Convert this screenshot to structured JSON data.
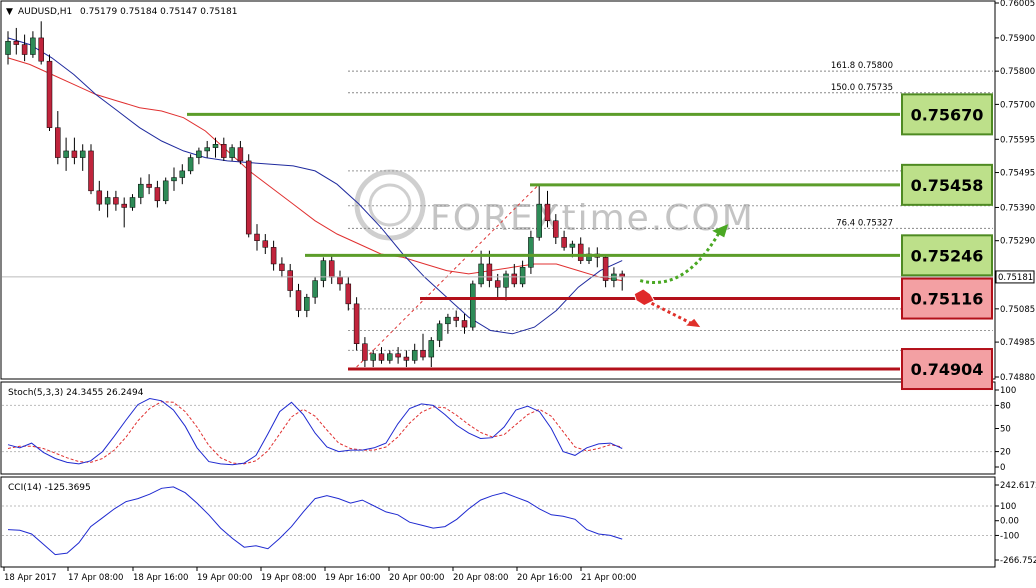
{
  "header": {
    "symbol": "AUDUSD,H1",
    "ohlc": "0.75179 0.75184 0.75147 0.75181"
  },
  "watermark": "FOREXtime.COM",
  "colors": {
    "bull": "#2e8b57",
    "bear": "#c0243c",
    "blue_ma": "#1f2a9e",
    "red_ma": "#e03030",
    "support": "#b3101a",
    "resistance": "#5c9d2a"
  },
  "fib_labels": [
    {
      "text": "161.8  0.75800",
      "price": 0.758
    },
    {
      "text": "150.0  0.75735",
      "price": 0.75735
    },
    {
      "text": "76.4  0.75327",
      "price": 0.75327
    }
  ],
  "price_axis": {
    "ticks": [
      "0.76005",
      "0.75900",
      "0.75800",
      "0.75700",
      "0.75595",
      "0.75495",
      "0.75390",
      "0.75290",
      "0.75190",
      "0.75085",
      "0.74985",
      "0.74880"
    ],
    "current": "0.75181"
  },
  "levels": [
    {
      "label": "0.75670",
      "kind": "resistance"
    },
    {
      "label": "0.75458",
      "kind": "resistance"
    },
    {
      "label": "0.75246",
      "kind": "resistance"
    },
    {
      "label": "0.75116",
      "kind": "support"
    },
    {
      "label": "0.74904",
      "kind": "support"
    }
  ],
  "stoch": {
    "title": "Stoch(5,3,3) 24.3455 26.2494",
    "ticks": [
      "100",
      "80",
      "50",
      "20",
      "0"
    ]
  },
  "cci": {
    "title": "CCI(14) -125.3695",
    "ticks": [
      "242.6172",
      "100",
      "0.00",
      "-100",
      "-266.7527"
    ]
  },
  "time_axis": [
    "18 Apr 2017",
    "17 Apr 08:00",
    "18 Apr 16:00",
    "19 Apr 00:00",
    "19 Apr 08:00",
    "19 Apr 16:00",
    "20 Apr 00:00",
    "20 Apr 08:00",
    "20 Apr 16:00",
    "21 Apr 00:00"
  ],
  "chart_data": {
    "type": "candlestick",
    "title": "AUDUSD,H1",
    "ylim": [
      0.7488,
      0.76005
    ],
    "candles": [
      [
        0.7585,
        0.7592,
        0.7582,
        0.7589
      ],
      [
        0.7589,
        0.7593,
        0.7585,
        0.7588
      ],
      [
        0.7588,
        0.7591,
        0.7583,
        0.7585
      ],
      [
        0.7585,
        0.7592,
        0.7584,
        0.759
      ],
      [
        0.759,
        0.7595,
        0.7582,
        0.7583
      ],
      [
        0.7583,
        0.7585,
        0.7562,
        0.7563
      ],
      [
        0.7563,
        0.7568,
        0.7552,
        0.7554
      ],
      [
        0.7554,
        0.756,
        0.755,
        0.7556
      ],
      [
        0.7556,
        0.756,
        0.7552,
        0.7554
      ],
      [
        0.7554,
        0.7558,
        0.755,
        0.7556
      ],
      [
        0.7556,
        0.7558,
        0.7543,
        0.7544
      ],
      [
        0.7544,
        0.7547,
        0.7538,
        0.754
      ],
      [
        0.754,
        0.7544,
        0.7536,
        0.7542
      ],
      [
        0.7542,
        0.7544,
        0.7538,
        0.754
      ],
      [
        0.754,
        0.7542,
        0.7533,
        0.7539
      ],
      [
        0.7539,
        0.7543,
        0.7538,
        0.7542
      ],
      [
        0.7542,
        0.7548,
        0.754,
        0.7546
      ],
      [
        0.7546,
        0.7549,
        0.7543,
        0.7545
      ],
      [
        0.7545,
        0.7547,
        0.7539,
        0.7541
      ],
      [
        0.7541,
        0.7548,
        0.754,
        0.7547
      ],
      [
        0.7547,
        0.7551,
        0.7544,
        0.7548
      ],
      [
        0.7548,
        0.7552,
        0.7546,
        0.755
      ],
      [
        0.755,
        0.7555,
        0.7549,
        0.7554
      ],
      [
        0.7554,
        0.7557,
        0.7552,
        0.7556
      ],
      [
        0.7556,
        0.7559,
        0.7554,
        0.7557
      ],
      [
        0.7557,
        0.756,
        0.7554,
        0.7558
      ],
      [
        0.7558,
        0.756,
        0.7553,
        0.7554
      ],
      [
        0.7554,
        0.7558,
        0.7553,
        0.7557
      ],
      [
        0.7557,
        0.7559,
        0.7552,
        0.7553
      ],
      [
        0.7553,
        0.7555,
        0.753,
        0.7531
      ],
      [
        0.7531,
        0.7534,
        0.7526,
        0.7529
      ],
      [
        0.7529,
        0.7531,
        0.7525,
        0.7527
      ],
      [
        0.7527,
        0.7529,
        0.752,
        0.7522
      ],
      [
        0.7522,
        0.7524,
        0.7518,
        0.752
      ],
      [
        0.752,
        0.7522,
        0.7512,
        0.7514
      ],
      [
        0.7514,
        0.7516,
        0.7506,
        0.7508
      ],
      [
        0.7508,
        0.7513,
        0.7506,
        0.7512
      ],
      [
        0.7512,
        0.7518,
        0.751,
        0.7517
      ],
      [
        0.7517,
        0.7524,
        0.7515,
        0.7523
      ],
      [
        0.7523,
        0.7525,
        0.7516,
        0.7518
      ],
      [
        0.7518,
        0.752,
        0.7514,
        0.7516
      ],
      [
        0.7516,
        0.7518,
        0.7508,
        0.751
      ],
      [
        0.751,
        0.7512,
        0.7496,
        0.7498
      ],
      [
        0.7498,
        0.75,
        0.7491,
        0.7493
      ],
      [
        0.7493,
        0.7496,
        0.7491,
        0.7495
      ],
      [
        0.7495,
        0.7497,
        0.7492,
        0.7493
      ],
      [
        0.7493,
        0.7496,
        0.7492,
        0.7495
      ],
      [
        0.7495,
        0.7497,
        0.7492,
        0.7494
      ],
      [
        0.7494,
        0.7496,
        0.7491,
        0.7493
      ],
      [
        0.7493,
        0.7498,
        0.7492,
        0.7496
      ],
      [
        0.7496,
        0.7501,
        0.7493,
        0.7494
      ],
      [
        0.7494,
        0.75,
        0.7491,
        0.7499
      ],
      [
        0.7499,
        0.7505,
        0.7497,
        0.7504
      ],
      [
        0.7504,
        0.7507,
        0.7501,
        0.7506
      ],
      [
        0.7506,
        0.7508,
        0.7503,
        0.7505
      ],
      [
        0.7505,
        0.7507,
        0.7501,
        0.7503
      ],
      [
        0.7503,
        0.7517,
        0.7502,
        0.7516
      ],
      [
        0.7516,
        0.7526,
        0.7515,
        0.7522
      ],
      [
        0.7522,
        0.7526,
        0.7515,
        0.7517
      ],
      [
        0.7517,
        0.7519,
        0.7512,
        0.7515
      ],
      [
        0.7515,
        0.752,
        0.7511,
        0.7519
      ],
      [
        0.7519,
        0.7522,
        0.7515,
        0.7516
      ],
      [
        0.7516,
        0.7523,
        0.7515,
        0.7521
      ],
      [
        0.7521,
        0.7532,
        0.7519,
        0.753
      ],
      [
        0.753,
        0.7546,
        0.7529,
        0.754
      ],
      [
        0.754,
        0.7544,
        0.7533,
        0.7535
      ],
      [
        0.7535,
        0.7537,
        0.7528,
        0.753
      ],
      [
        0.753,
        0.7532,
        0.7526,
        0.7527
      ],
      [
        0.7527,
        0.7529,
        0.7524,
        0.7528
      ],
      [
        0.7528,
        0.753,
        0.7522,
        0.7523
      ],
      [
        0.7523,
        0.7527,
        0.7522,
        0.7525
      ],
      [
        0.7525,
        0.7527,
        0.7521,
        0.7524
      ],
      [
        0.7524,
        0.7525,
        0.7515,
        0.7517
      ],
      [
        0.7517,
        0.7521,
        0.7515,
        0.7519
      ],
      [
        0.7519,
        0.752,
        0.7514,
        0.75181
      ]
    ],
    "ma_blue": [
      0.759,
      0.7588,
      0.7584,
      0.7579,
      0.7573,
      0.7568,
      0.7563,
      0.7559,
      0.7556,
      0.7554,
      0.7553,
      0.75525,
      0.7552,
      0.75515,
      0.755,
      0.7546,
      0.754,
      0.7533,
      0.7525,
      0.7518,
      0.7512,
      0.7506,
      0.7502,
      0.7501,
      0.7503,
      0.7508,
      0.7515,
      0.752,
      0.7523
    ],
    "ma_red": [
      0.7584,
      0.7582,
      0.7579,
      0.7576,
      0.7573,
      0.7571,
      0.7569,
      0.7568,
      0.7566,
      0.7562,
      0.7556,
      0.755,
      0.7545,
      0.754,
      0.7535,
      0.7531,
      0.7528,
      0.7525,
      0.7524,
      0.7522,
      0.752,
      0.7519,
      0.752,
      0.7521,
      0.7522,
      0.7522,
      0.752,
      0.7518,
      0.7517
    ],
    "fib_lines": [
      0.758,
      0.75735,
      0.75327
    ],
    "levels": [
      0.7567,
      0.75458,
      0.75246,
      0.75116,
      0.74904
    ],
    "stoch_main": [
      29,
      25,
      31,
      19,
      11,
      6,
      4,
      8,
      20,
      40,
      61,
      81,
      89,
      86,
      74,
      53,
      25,
      7,
      4,
      3,
      5,
      15,
      43,
      72,
      84,
      68,
      44,
      26,
      20,
      22,
      22,
      25,
      31,
      56,
      76,
      82,
      80,
      68,
      54,
      44,
      37,
      38,
      52,
      74,
      79,
      72,
      50,
      20,
      15,
      25,
      30,
      31,
      24
    ],
    "stoch_signal": [
      24,
      27,
      27,
      24,
      18,
      12,
      7,
      6,
      11,
      22,
      39,
      60,
      76,
      85,
      84,
      72,
      52,
      28,
      12,
      5,
      4,
      8,
      21,
      43,
      65,
      75,
      66,
      48,
      31,
      24,
      22,
      22,
      26,
      39,
      57,
      71,
      78,
      77,
      67,
      55,
      45,
      39,
      42,
      55,
      68,
      75,
      66,
      46,
      26,
      21,
      24,
      29,
      26
    ],
    "cci": [
      -60,
      -65,
      -90,
      -160,
      -230,
      -220,
      -150,
      -40,
      20,
      80,
      130,
      150,
      180,
      220,
      230,
      190,
      120,
      40,
      -50,
      -120,
      -180,
      -170,
      -190,
      -120,
      -40,
      60,
      150,
      170,
      150,
      120,
      140,
      100,
      60,
      40,
      -10,
      -30,
      -50,
      -40,
      10,
      80,
      140,
      170,
      190,
      160,
      130,
      80,
      40,
      30,
      10,
      -60,
      -90,
      -100,
      -125
    ]
  }
}
